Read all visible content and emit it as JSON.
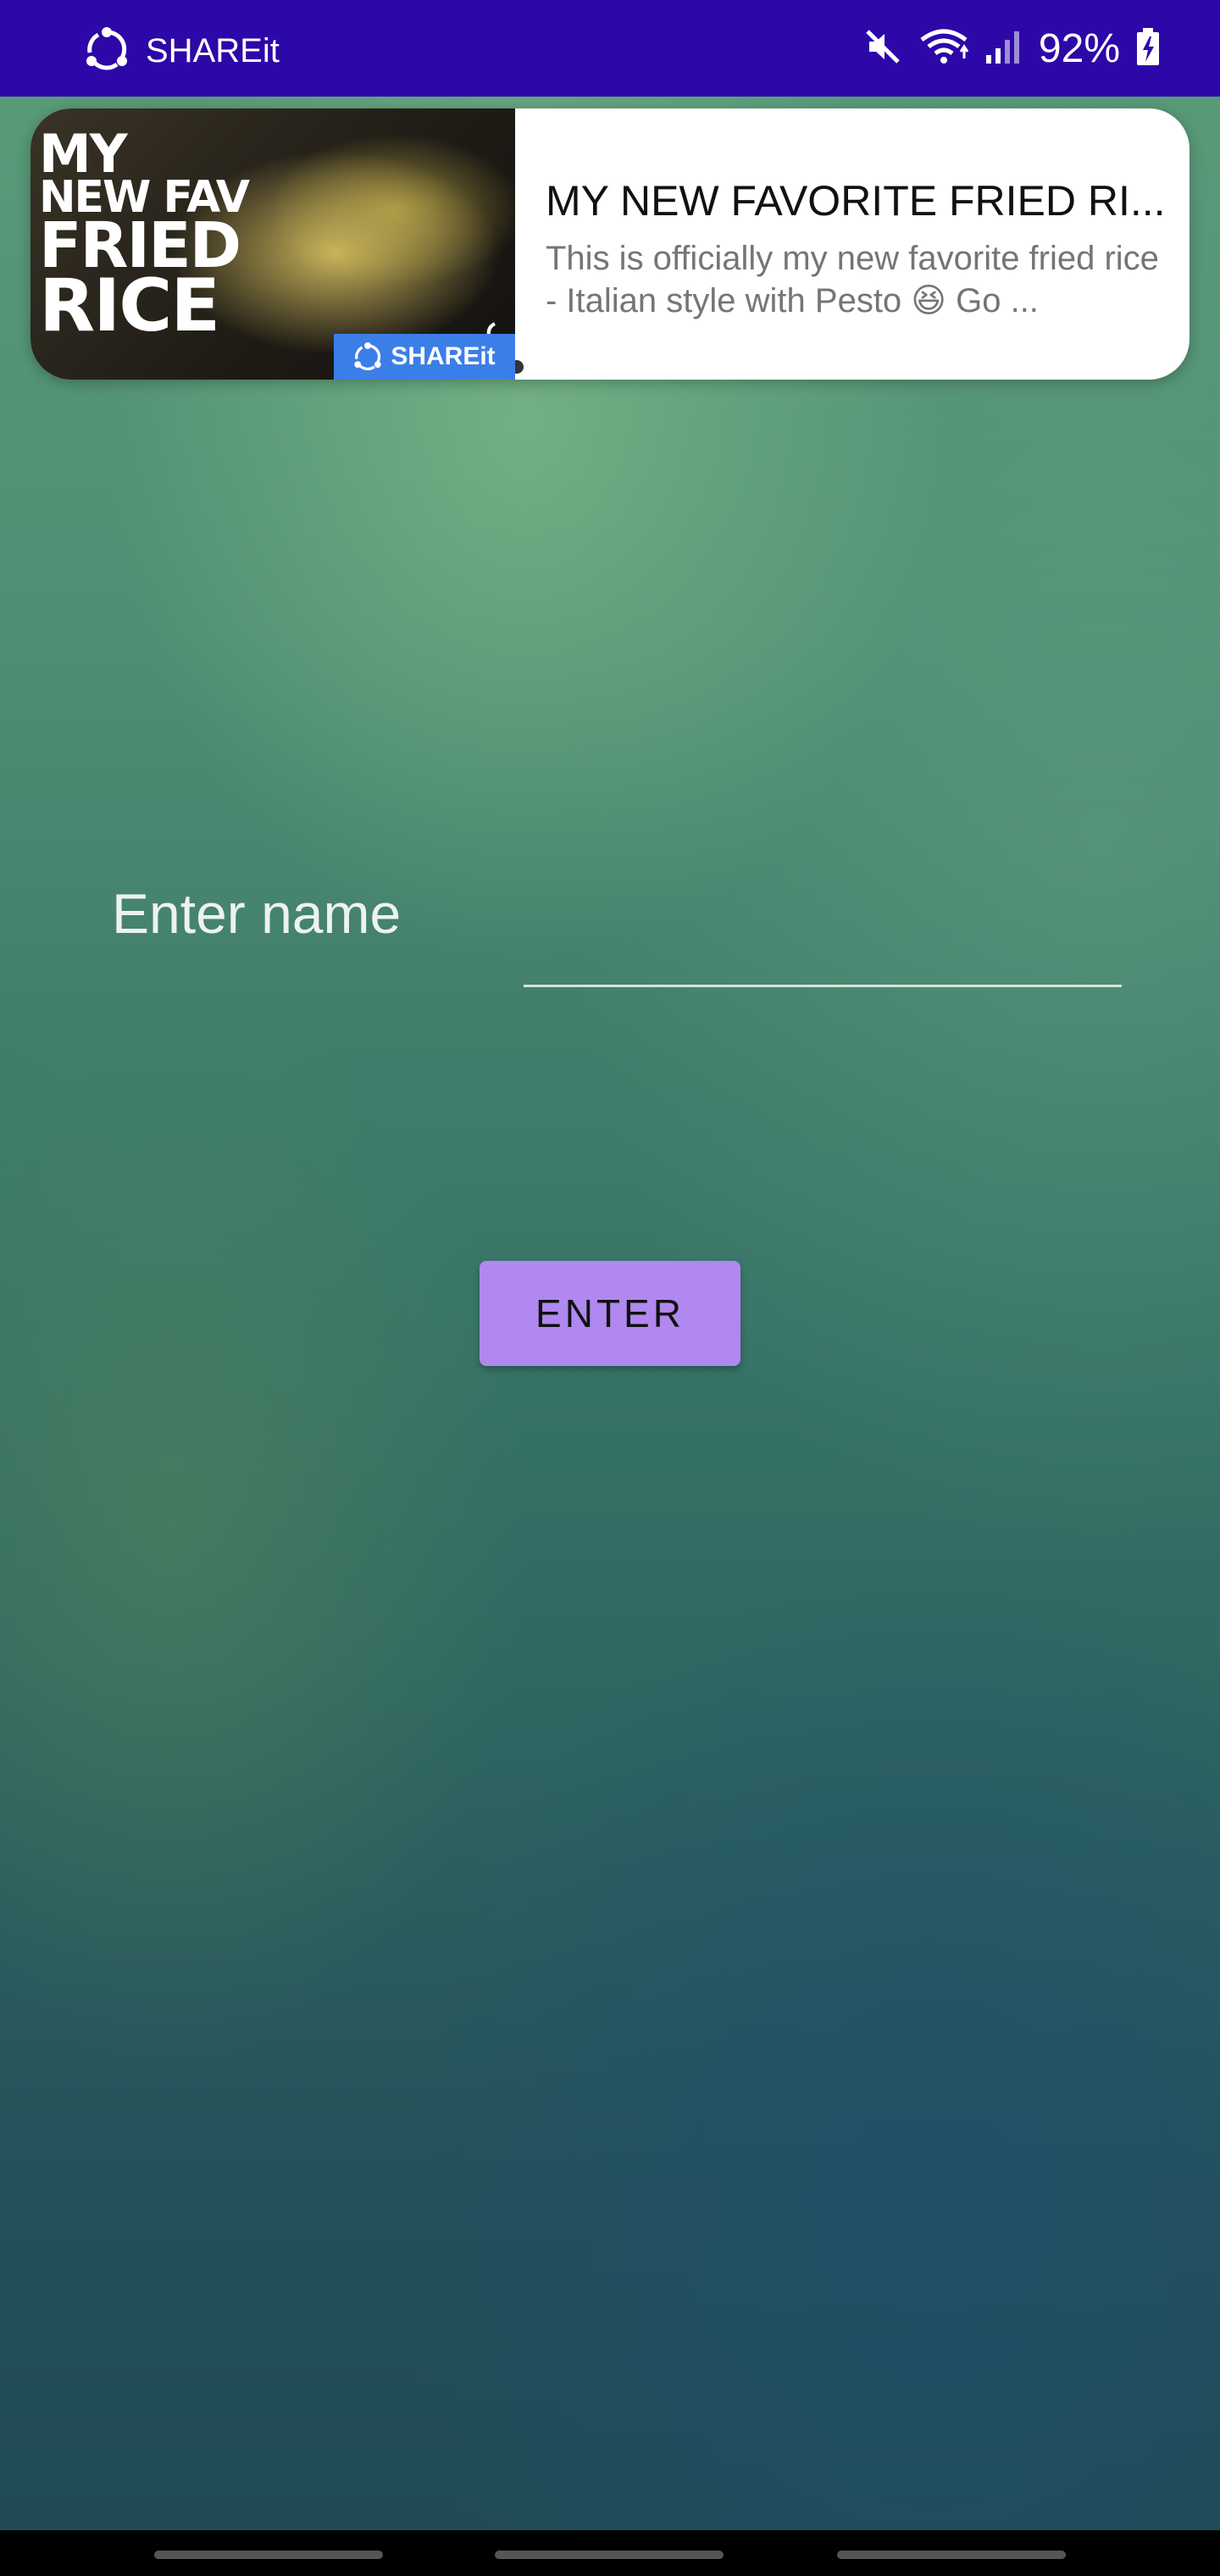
{
  "status_bar": {
    "app_label": "SHAREit",
    "battery": "92%",
    "icons": [
      "shareit-icon",
      "mute-icon",
      "wifi-icon",
      "signal-icon",
      "battery-charging-icon"
    ]
  },
  "notification": {
    "thumbnail_text": [
      "MY",
      "NEW FAV",
      "FRIED",
      "RICE"
    ],
    "badge_label": "SHAREit",
    "title": "MY NEW FAVORITE FRIED RI...",
    "body": "This is officially my new favorite fried rice - Italian style with Pesto 😆 Go ..."
  },
  "form": {
    "name_label": "Enter name",
    "name_value": "",
    "enter_button_label": "ENTER"
  },
  "colors": {
    "status_bar": "#2e07a8",
    "button": "#b088f0",
    "badge": "#3c7ee8"
  }
}
